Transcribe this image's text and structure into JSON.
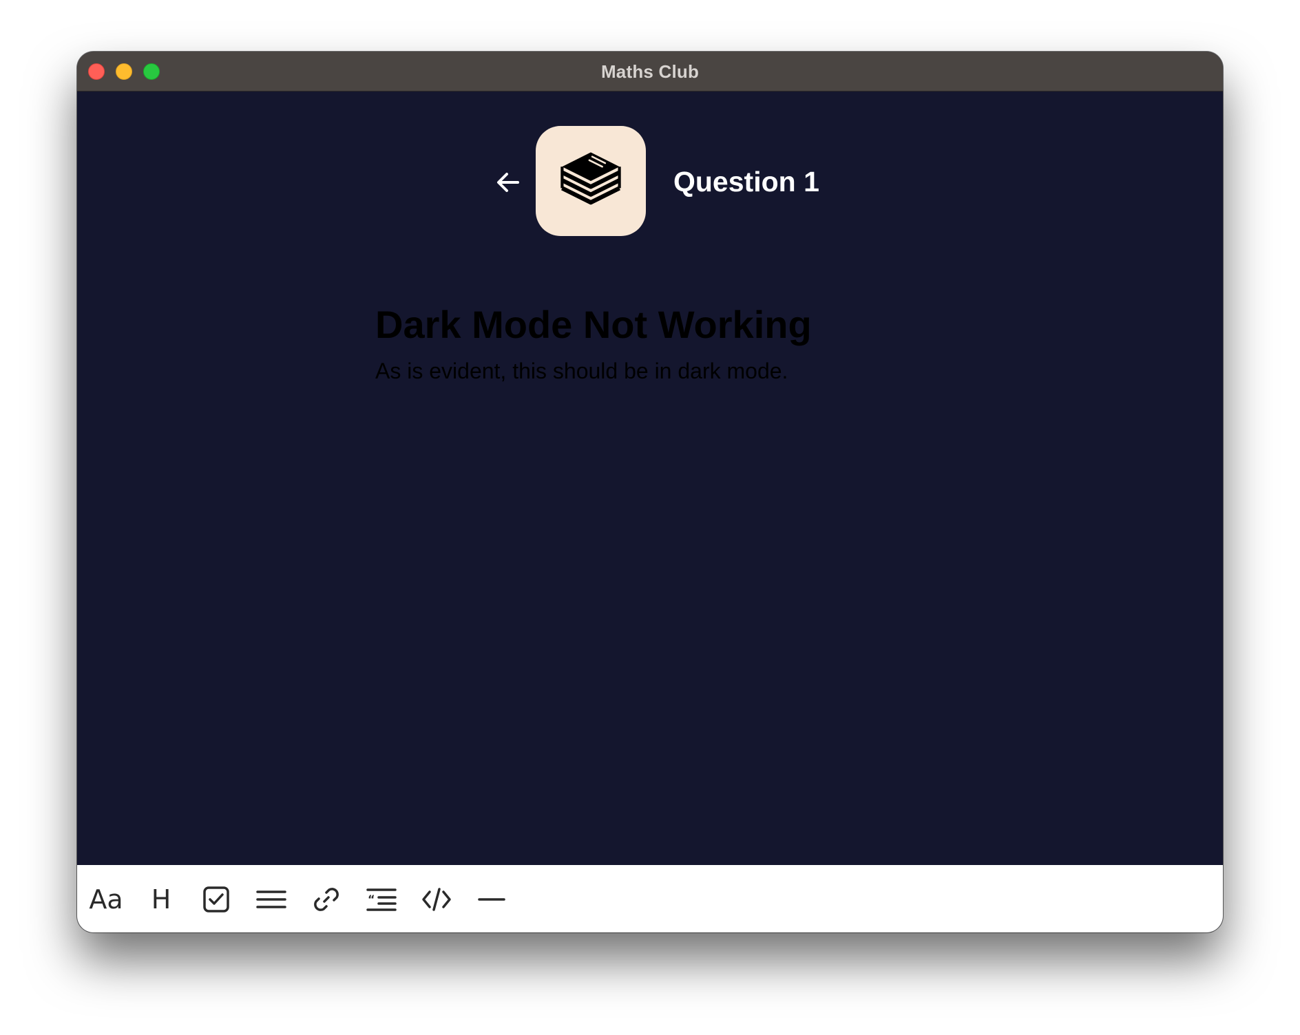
{
  "window": {
    "title": "Maths Club"
  },
  "header": {
    "title": "Question 1",
    "back_icon": "arrow-left-icon",
    "app_icon": "stacked-books-icon"
  },
  "document": {
    "heading": "Dark Mode Not Working",
    "paragraph": "As is evident, this should be in dark mode."
  },
  "toolbar": {
    "items": [
      {
        "label": "Aa",
        "icon": "text-style-icon"
      },
      {
        "label": "H",
        "icon": "heading-icon"
      },
      {
        "icon": "checkbox-icon"
      },
      {
        "icon": "list-icon"
      },
      {
        "icon": "link-icon"
      },
      {
        "icon": "blockquote-icon"
      },
      {
        "icon": "code-icon"
      },
      {
        "icon": "horizontal-rule-icon"
      }
    ]
  },
  "colors": {
    "background": "#14162e",
    "titlebar": "#4a4542",
    "app_icon_bg": "#f8e7d6",
    "toolbar_bg": "#ffffff"
  }
}
